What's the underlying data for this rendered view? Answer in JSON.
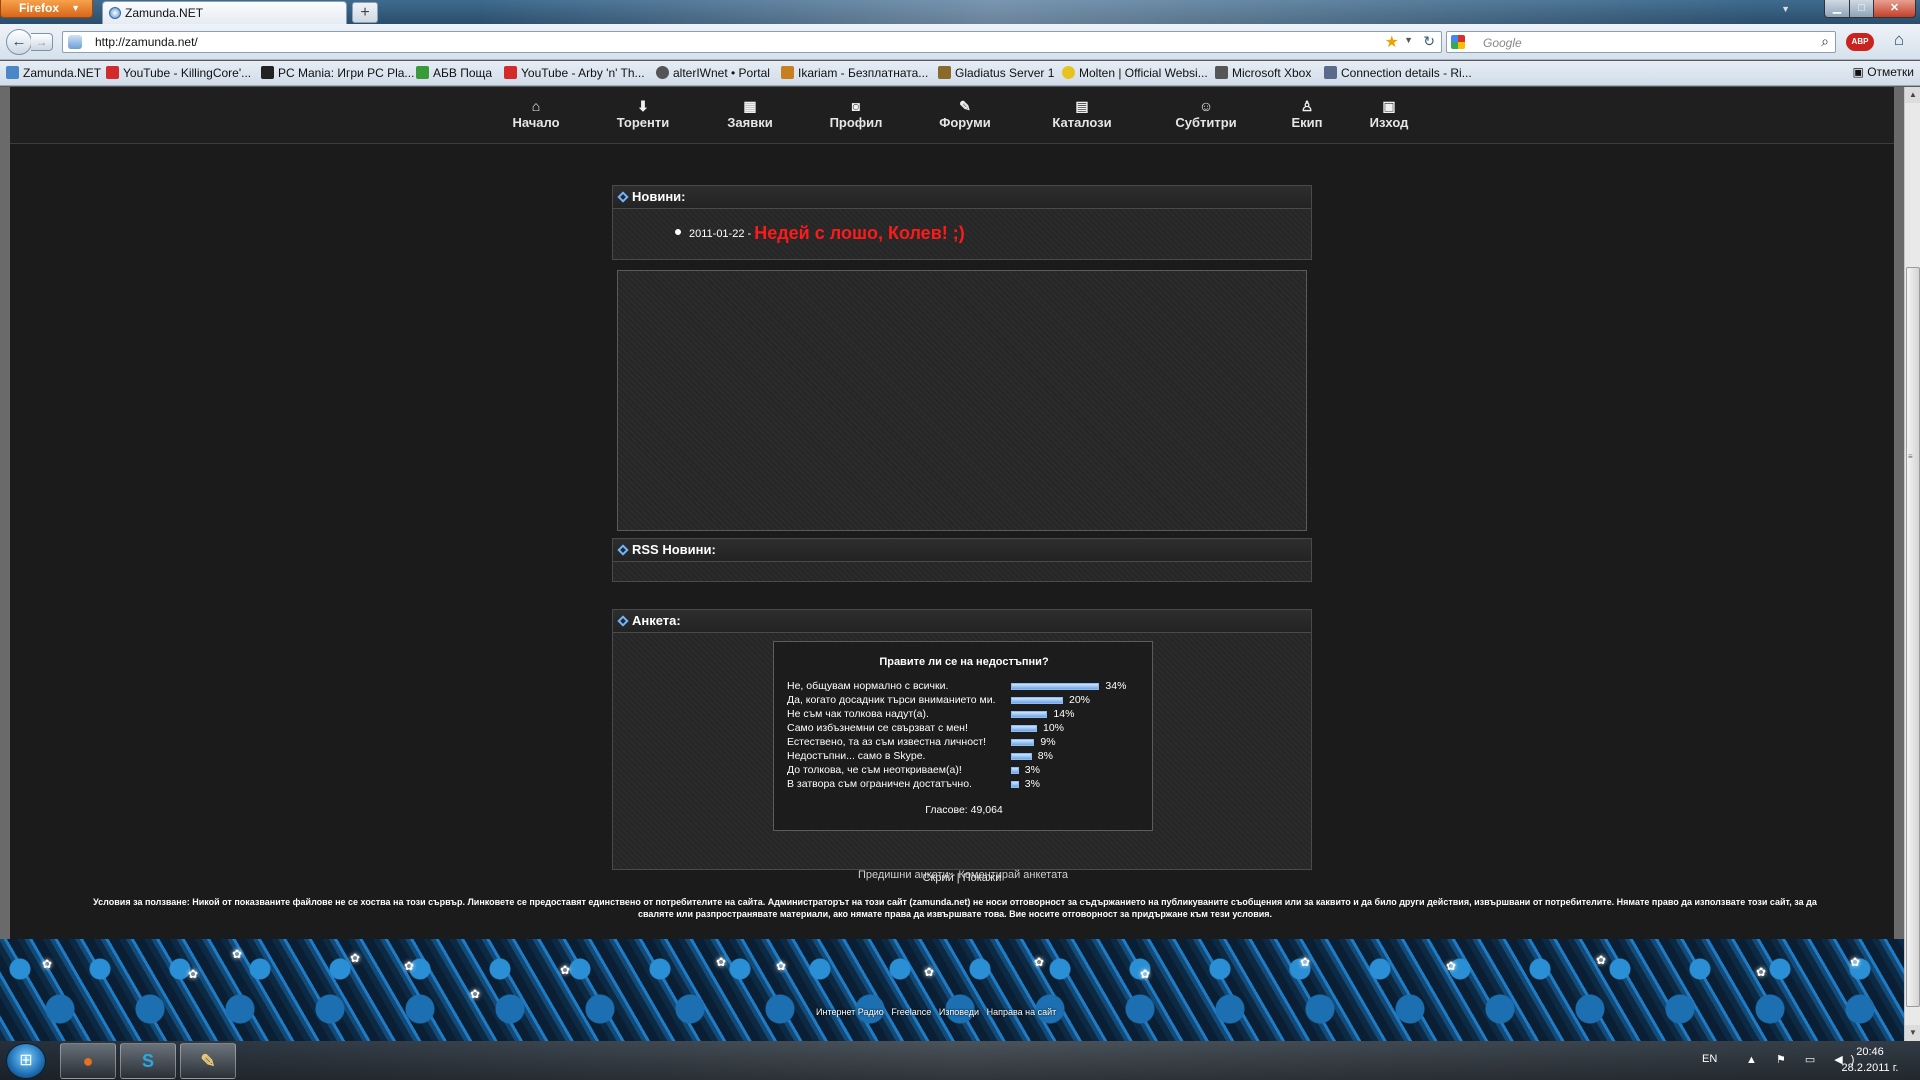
{
  "browser": {
    "app_button": "Firefox",
    "tab_title": "Zamunda.NET",
    "new_tab": "+",
    "url": "http://zamunda.net/",
    "search_placeholder": "Google",
    "bookmarks_more": "Отметки",
    "bookmarks": [
      {
        "label": "Zamunda.NET",
        "icon": "globe-icon",
        "color": "#4b86c7"
      },
      {
        "label": "YouTube - KillingCore'...",
        "icon": "youtube-icon",
        "color": "#d32a2a"
      },
      {
        "label": "PC Mania: Игри PC Pla...",
        "icon": "pcmania-icon",
        "color": "#222222"
      },
      {
        "label": "АБВ Поща",
        "icon": "house-icon",
        "color": "#3a9a3a"
      },
      {
        "label": "YouTube - Arby 'n' Th...",
        "icon": "youtube-icon",
        "color": "#d32a2a"
      },
      {
        "label": "alterIWnet • Portal",
        "icon": "gear-icon",
        "color": "#555555"
      },
      {
        "label": "Ikariam - Безплатната...",
        "icon": "ikariam-icon",
        "color": "#c8801e"
      },
      {
        "label": "Gladiatus Server 1",
        "icon": "helmet-icon",
        "color": "#8a6a2a"
      },
      {
        "label": "Molten | Official Websi...",
        "icon": "molten-icon",
        "color": "#e8c21e"
      },
      {
        "label": "Microsoft Xbox",
        "icon": "xbox-icon",
        "color": "#555555"
      },
      {
        "label": "Connection details - Ri...",
        "icon": "connection-icon",
        "color": "#5a6a8a"
      }
    ]
  },
  "site": {
    "nav": [
      {
        "label": "Начало",
        "icon": "home-icon",
        "glyph": "⌂"
      },
      {
        "label": "Торенти",
        "icon": "download-icon",
        "glyph": "⬇"
      },
      {
        "label": "Заявки",
        "icon": "requests-icon",
        "glyph": "▦"
      },
      {
        "label": "Профил",
        "icon": "profile-icon",
        "glyph": "◙"
      },
      {
        "label": "Форуми",
        "icon": "forums-icon",
        "glyph": "✎"
      },
      {
        "label": "Каталози",
        "icon": "catalog-icon",
        "glyph": "▤"
      },
      {
        "label": "Субтитри",
        "icon": "subtitles-icon",
        "glyph": "☺"
      },
      {
        "label": "Екип",
        "icon": "team-icon",
        "glyph": "♙"
      },
      {
        "label": "Изход",
        "icon": "logout-icon",
        "glyph": "▣"
      }
    ],
    "news": {
      "title": "Новини:",
      "date": "2011-01-22 -",
      "headline": "Недей с лошо, Колев! ;)",
      "headline_color": "#ff1a1a"
    },
    "rss": {
      "title": "RSS Новини:"
    },
    "poll": {
      "title": "Анкета:",
      "question": "Правите ли се на недостъпни?",
      "options": [
        {
          "label": "Не, общувам нормално с всички.",
          "pct": 34,
          "text": "34%"
        },
        {
          "label": "Да, когато досадник търси вниманието ми.",
          "pct": 20,
          "text": "20%"
        },
        {
          "label": "Не съм чак толкова надут(а).",
          "pct": 14,
          "text": "14%"
        },
        {
          "label": "Само избъзнемни се свързват с мен!",
          "pct": 10,
          "text": "10%"
        },
        {
          "label": "Естествено, та аз съм известна личност!",
          "pct": 9,
          "text": "9%"
        },
        {
          "label": "Недостъпни... само в Skype.",
          "pct": 8,
          "text": "8%"
        },
        {
          "label": "До толкова, че съм неоткриваем(а)!",
          "pct": 3,
          "text": "3%"
        },
        {
          "label": "В затвора съм ограничен достатъчно.",
          "pct": 3,
          "text": "3%"
        }
      ],
      "votes": "Гласове: 49,064",
      "prev_link": "Предишни анкети",
      "separator": "-",
      "comment_link": "Коментирай анкетата"
    },
    "hide_label": "Скрий",
    "pipe": "|",
    "show_label": "Покажи",
    "terms": "Условия за ползване: Никой от показваните файлове не се хоства на този сървър. Линковете се предоставят единствено от потребителите на сайта. Администраторът на този сайт (zamunda.net) не носи отговорност за съдържанието на публикуваните съобщения или за каквито и да било други действия, извършвани от потребителите. Нямате право да използвате този сайт, за да сваляте или разпространявате материали, ако нямате права да извършвате това. Вие носите отговорност за придържане към тези условия.",
    "footer_links": [
      "Интернет Радио",
      "Freelance",
      "Изповеди",
      "Направа на сайт"
    ]
  },
  "taskbar": {
    "apps": [
      {
        "name": "firefox",
        "icon": "firefox-icon",
        "glyph": "●",
        "color": "#e8701e"
      },
      {
        "name": "skype",
        "icon": "skype-icon",
        "glyph": "S",
        "color": "#2aa8e8"
      },
      {
        "name": "paint",
        "icon": "paint-icon",
        "glyph": "✎",
        "color": "#e8c87a"
      }
    ],
    "lang": "EN",
    "tray_icons": "▲ ⚑ ▭ ◀)",
    "time": "20:46",
    "date": "28.2.2011 г."
  }
}
